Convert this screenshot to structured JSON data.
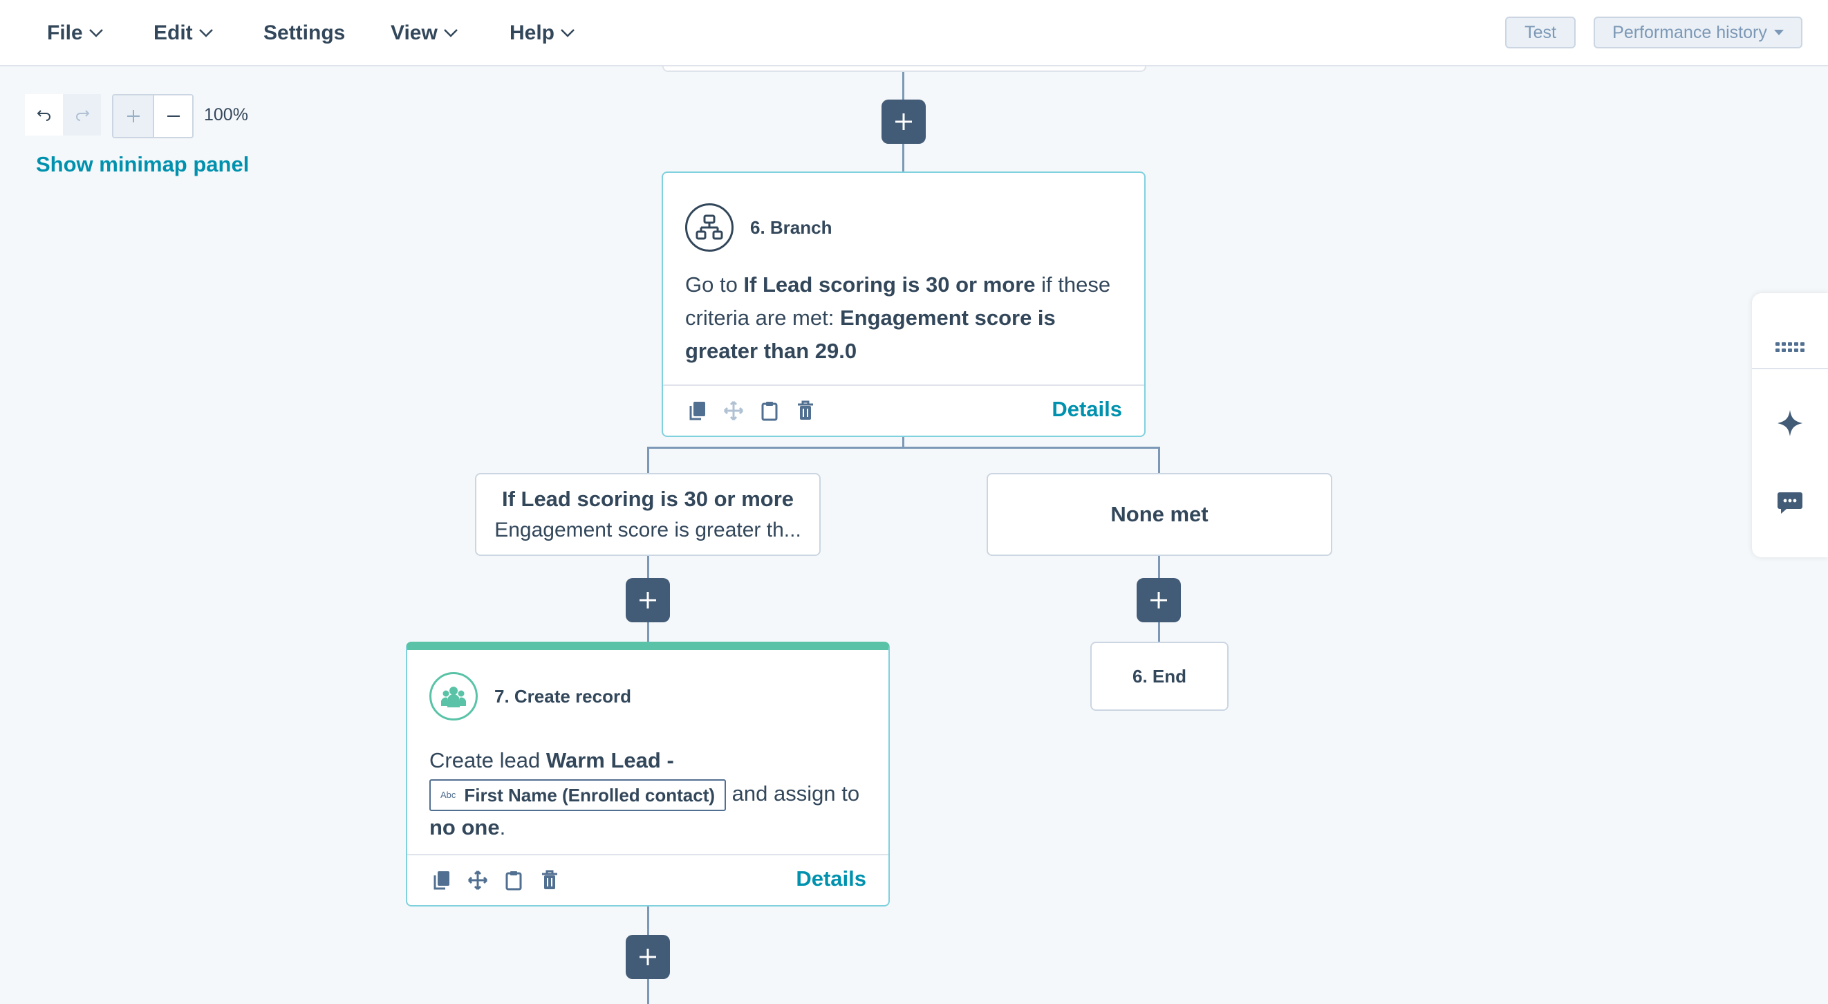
{
  "menubar": {
    "items": [
      "File",
      "Edit",
      "Settings",
      "View",
      "Help"
    ],
    "test_label": "Test",
    "performance_label": "Performance history"
  },
  "canvas_toolbar": {
    "zoom_level": "100%",
    "minimap_label": "Show minimap panel"
  },
  "branch_action": {
    "title": "6. Branch",
    "body_prefix": "Go to ",
    "target": "If Lead scoring is 30 or more",
    "body_mid": " if these criteria are met: ",
    "criteria": "Engagement score is greater than 29.0",
    "details_label": "Details"
  },
  "branches": [
    {
      "name": "If Lead scoring is 30 or more",
      "description": "Engagement score is greater th..."
    },
    {
      "name": "None met",
      "description": ""
    }
  ],
  "create_record_action": {
    "title": "7. Create record",
    "prefix": "Create lead ",
    "lead_name": "Warm Lead -",
    "token_prefix": "Abc",
    "token_label": "First Name (Enrolled contact)",
    "mid": " and assign to",
    "owner": "no one",
    "suffix": ".",
    "details_label": "Details"
  },
  "end_action": {
    "title": "6. End"
  },
  "colors": {
    "accent": "#0091ae",
    "node_dark": "#425b76",
    "card_border": "#7fd1de",
    "create_record_bar": "#5ac3a7"
  },
  "icons": {
    "branch": "branch-icon",
    "create_record": "people-icon",
    "side_panel": [
      "grid-icon",
      "sparkle-icon",
      "chat-icon"
    ]
  }
}
